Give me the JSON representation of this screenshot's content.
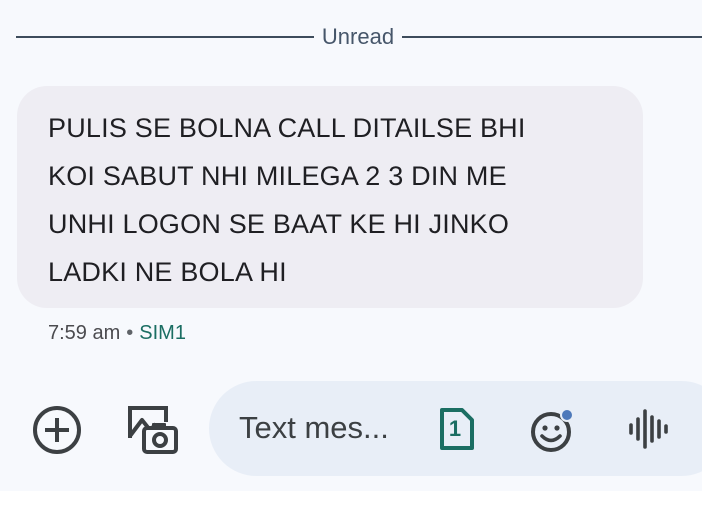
{
  "divider": {
    "label": "Unread"
  },
  "message": {
    "text": "PULIS SE BOLNA CALL DITAILSE BHI\nKOI SABUT NHI MILEGA 2 3 DIN ME\nUNHI LOGON SE BAAT KE HI JINKO\nLADKI NE BOLA HI",
    "time": "7:59 am",
    "separator": "•",
    "sim": "SIM1"
  },
  "composer": {
    "placeholder": "Text mes...",
    "sim_slot": "1",
    "icons": {
      "add": "add-circle-icon",
      "media": "gallery-camera-icon",
      "sim": "sim-card-icon",
      "emoji": "emoji-icon",
      "voice": "voice-waveform-icon"
    }
  },
  "colors": {
    "background": "#f7f9fd",
    "bubble": "#eeedf3",
    "composer": "#e8eef7",
    "accent": "#1b6e63",
    "notification_dot": "#4e79ba"
  }
}
